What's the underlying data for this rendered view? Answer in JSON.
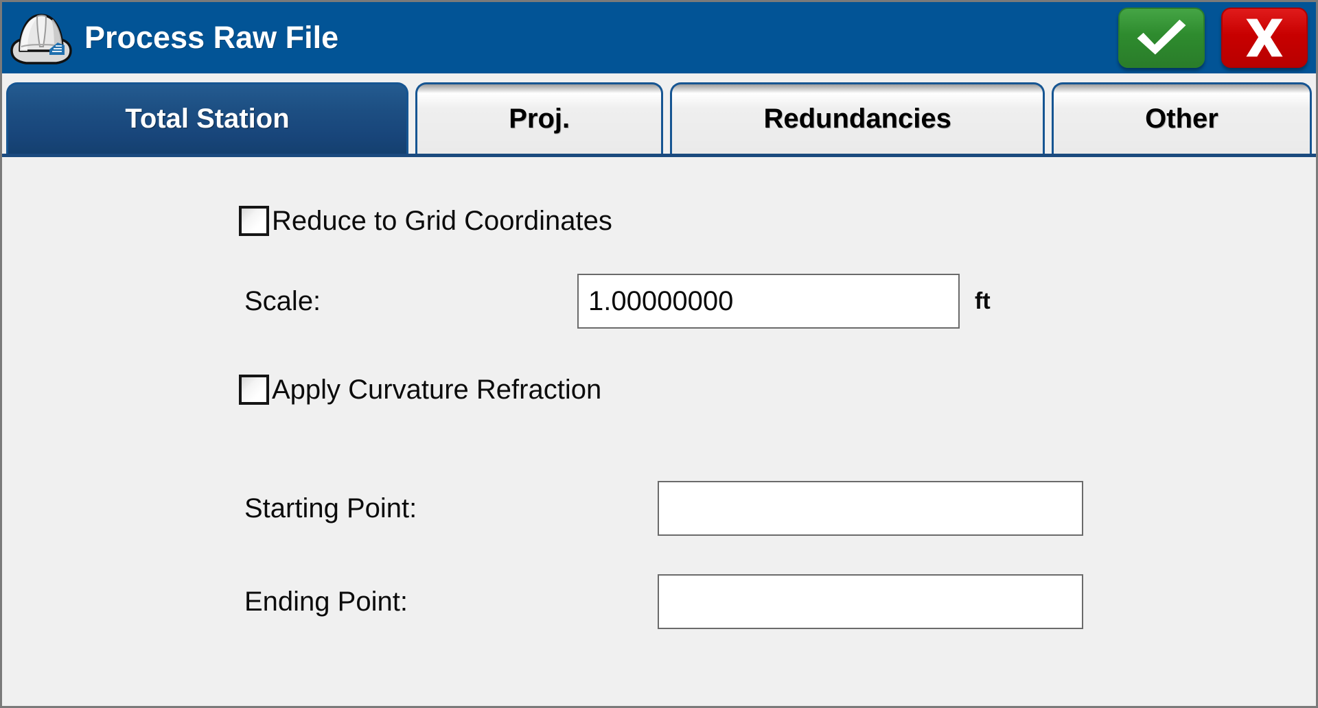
{
  "window": {
    "title": "Process Raw File",
    "icon": "hard-hat-icon",
    "header_color": "#025496",
    "accent_color": "#1b4a7e",
    "content_bg": "#f0f0f0"
  },
  "titlebar_actions": {
    "accept": {
      "label": "✓",
      "icon": "checkmark-icon",
      "color": "#2e8b2e"
    },
    "cancel": {
      "label": "X",
      "icon": "close-x-icon",
      "color": "#c80000"
    }
  },
  "tabs": [
    {
      "label": "Total Station",
      "active": true
    },
    {
      "label": "Proj.",
      "active": false
    },
    {
      "label": "Redundancies",
      "active": false
    },
    {
      "label": "Other",
      "active": false
    }
  ],
  "form": {
    "reduce_to_grid": {
      "label": "Reduce to Grid Coordinates",
      "checked": false
    },
    "scale": {
      "label": "Scale:",
      "value": "1.00000000",
      "placeholder": "",
      "unit": "ft"
    },
    "apply_curvature_refraction": {
      "label": "Apply Curvature Refraction",
      "checked": false
    },
    "starting_point": {
      "label": "Starting Point:",
      "value": "",
      "placeholder": ""
    },
    "ending_point": {
      "label": "Ending Point:",
      "value": "",
      "placeholder": ""
    }
  }
}
